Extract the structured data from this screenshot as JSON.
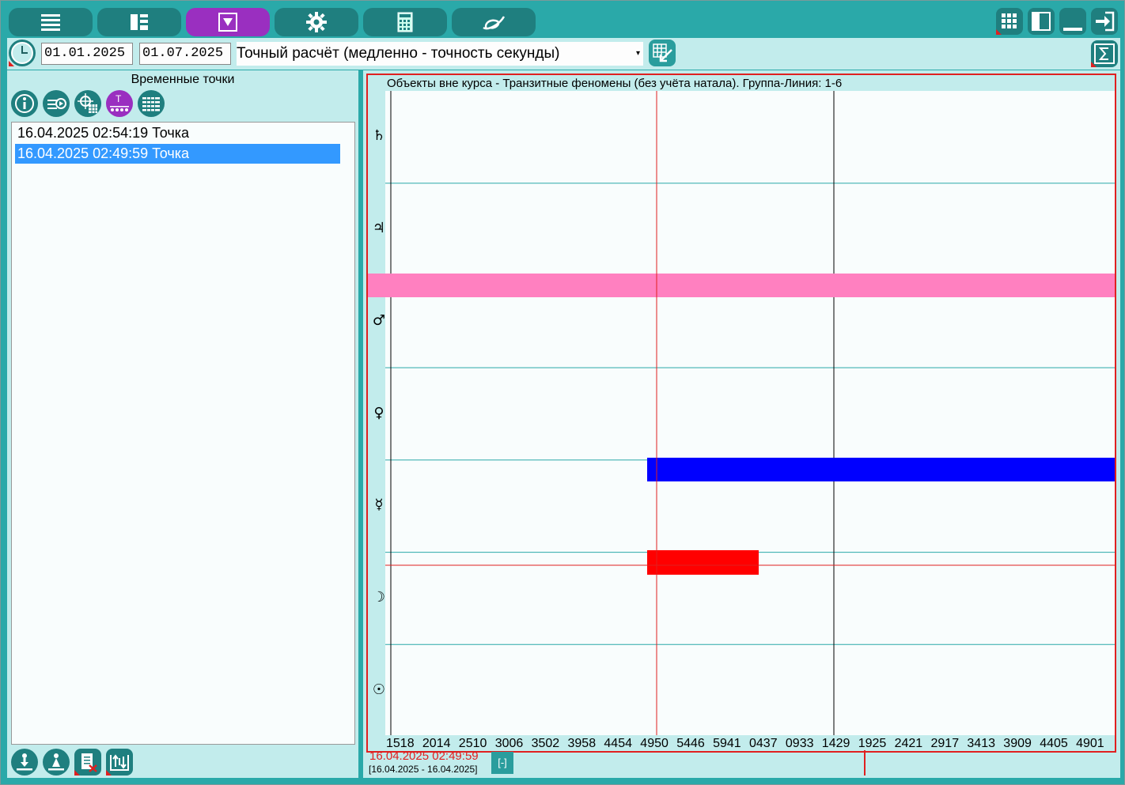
{
  "toolbar": {
    "tabs": [
      {
        "icon": "list-icon",
        "active": false
      },
      {
        "icon": "layout-icon",
        "active": false
      },
      {
        "icon": "dropdown-filter-icon",
        "active": true
      },
      {
        "icon": "gear-icon",
        "active": false
      },
      {
        "icon": "calculator-icon",
        "active": false
      },
      {
        "icon": "logo-icon",
        "active": false
      }
    ],
    "window_icons": [
      "grid-icon",
      "panel-icon",
      "minimize-icon",
      "exit-icon"
    ]
  },
  "range": {
    "start_date": "01.01.2025",
    "end_date": "01.07.2025",
    "mode": "Точный расчёт (медленно - точность секунды)"
  },
  "left_panel": {
    "title": "Временные точки",
    "items": [
      {
        "label": "16.04.2025 02:54:19 Точка",
        "selected": false
      },
      {
        "label": "16.04.2025 02:49:59 Точка",
        "selected": true
      }
    ]
  },
  "chart": {
    "title": "Объекты вне курса - Транзитные феномены (без учёта натала). Группа-Линия: 1-6",
    "planets": [
      "♄",
      "♃",
      "♂",
      "♀",
      "☿",
      "☽",
      "☉"
    ],
    "x_ticks": [
      "1518",
      "2014",
      "2510",
      "3006",
      "3502",
      "3958",
      "4454",
      "4950",
      "5446",
      "5941",
      "0437",
      "0933",
      "1429",
      "1925",
      "2421",
      "2917",
      "3413",
      "3909",
      "4405",
      "4901"
    ],
    "cursor_label": "16.04.2025 02:49:59",
    "range_label": "[16.04.2025 - 16.04.2025]",
    "zoom_button": "[-]",
    "colors": {
      "pink": "#ff80c0",
      "blue": "#0000ff",
      "red": "#ff0000",
      "frame": "#e02020",
      "grid": "#2aa9a9"
    }
  }
}
